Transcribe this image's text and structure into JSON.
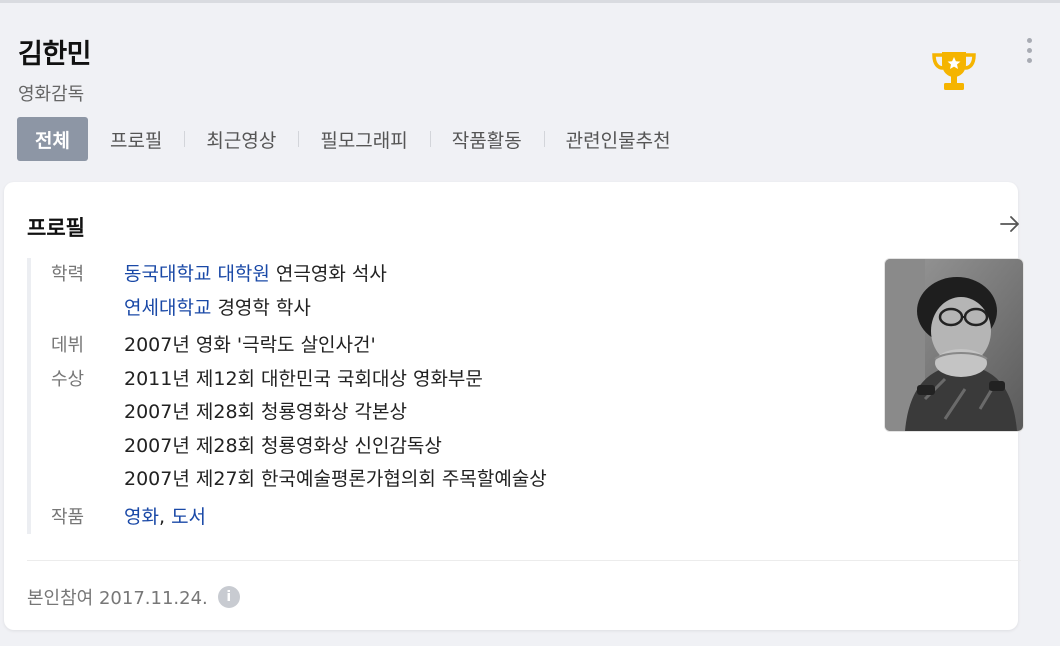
{
  "header": {
    "name": "김한민",
    "subtitle": "영화감독",
    "trophy_icon": "trophy-icon",
    "more_icon": "more-vertical-icon"
  },
  "tabs": [
    {
      "label": "전체",
      "active": true
    },
    {
      "label": "프로필",
      "active": false
    },
    {
      "label": "최근영상",
      "active": false
    },
    {
      "label": "필모그래피",
      "active": false
    },
    {
      "label": "작품활동",
      "active": false
    },
    {
      "label": "관련인물추천",
      "active": false
    }
  ],
  "profile": {
    "title": "프로필",
    "education_label": "학력",
    "education": [
      {
        "link": "동국대학교 대학원",
        "text": " 연극영화 석사"
      },
      {
        "link": "연세대학교",
        "text": " 경영학 학사"
      }
    ],
    "debut_label": "데뷔",
    "debut": "2007년 영화 '극락도 살인사건'",
    "awards_label": "수상",
    "awards": [
      "2011년 제12회 대한민국 국회대상 영화부문",
      "2007년 제28회 청룡영화상 각본상",
      "2007년 제28회 청룡영화상 신인감독상",
      "2007년 제27회 한국예술평론가협의회 주목할예술상"
    ],
    "works_label": "작품",
    "works_link1": "영화",
    "works_sep": ", ",
    "works_link2": "도서",
    "footer": "본인참여 2017.11.24.",
    "info_icon": "i"
  },
  "colors": {
    "accent_link": "#1a49a7",
    "active_tab": "#8d96a5",
    "trophy": "#f5b400"
  }
}
